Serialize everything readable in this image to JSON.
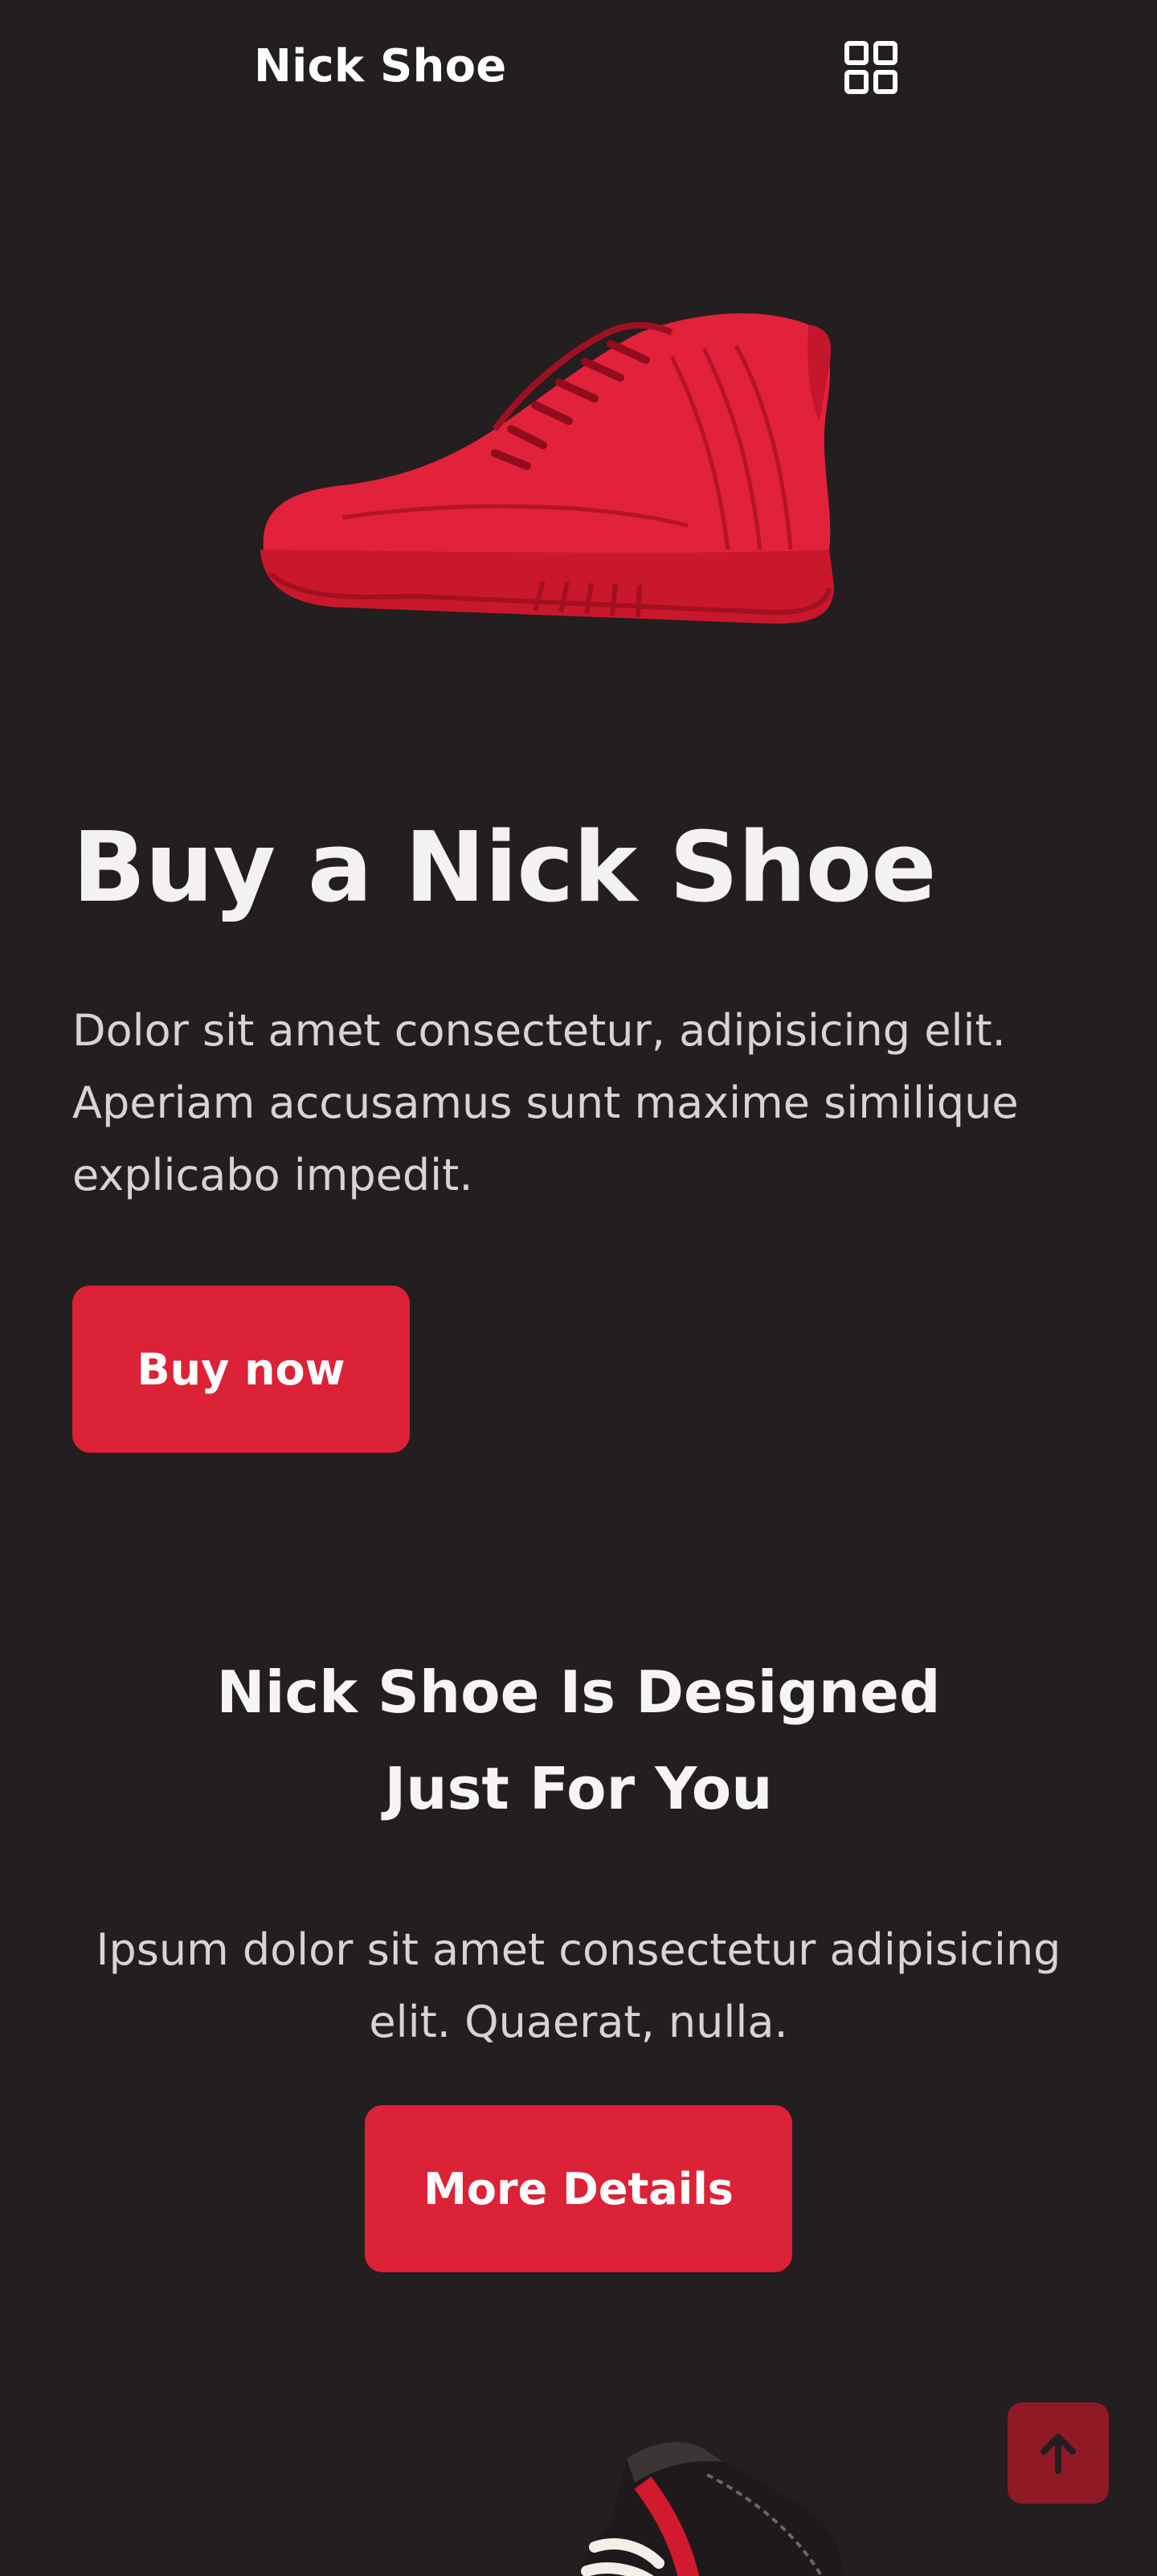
{
  "header": {
    "brand": "Nick Shoe",
    "menu_icon": "grid-menu-icon"
  },
  "hero": {
    "image_icon": "red-sneaker-image",
    "title": "Buy a Nick Shoe",
    "description": "Dolor sit amet consectetur, adipisicing elit. Aperiam accusamus sunt maxime similique explicabo impedit.",
    "button_label": "Buy now"
  },
  "feature": {
    "title_line1": "Nick Shoe Is Designed",
    "title_line2": "Just For You",
    "description": "Ipsum dolor sit amet consectetur adipisicing elit. Quaerat, nulla.",
    "button_label": "More Details",
    "image_icon": "black-sneaker-image"
  },
  "scroll_top": {
    "icon": "arrow-up-icon"
  },
  "colors": {
    "background": "#231e1f",
    "accent": "#dc2236",
    "scroll_button": "#8f1a26",
    "text": "#ffffff",
    "muted_text": "#d9d3d3"
  }
}
